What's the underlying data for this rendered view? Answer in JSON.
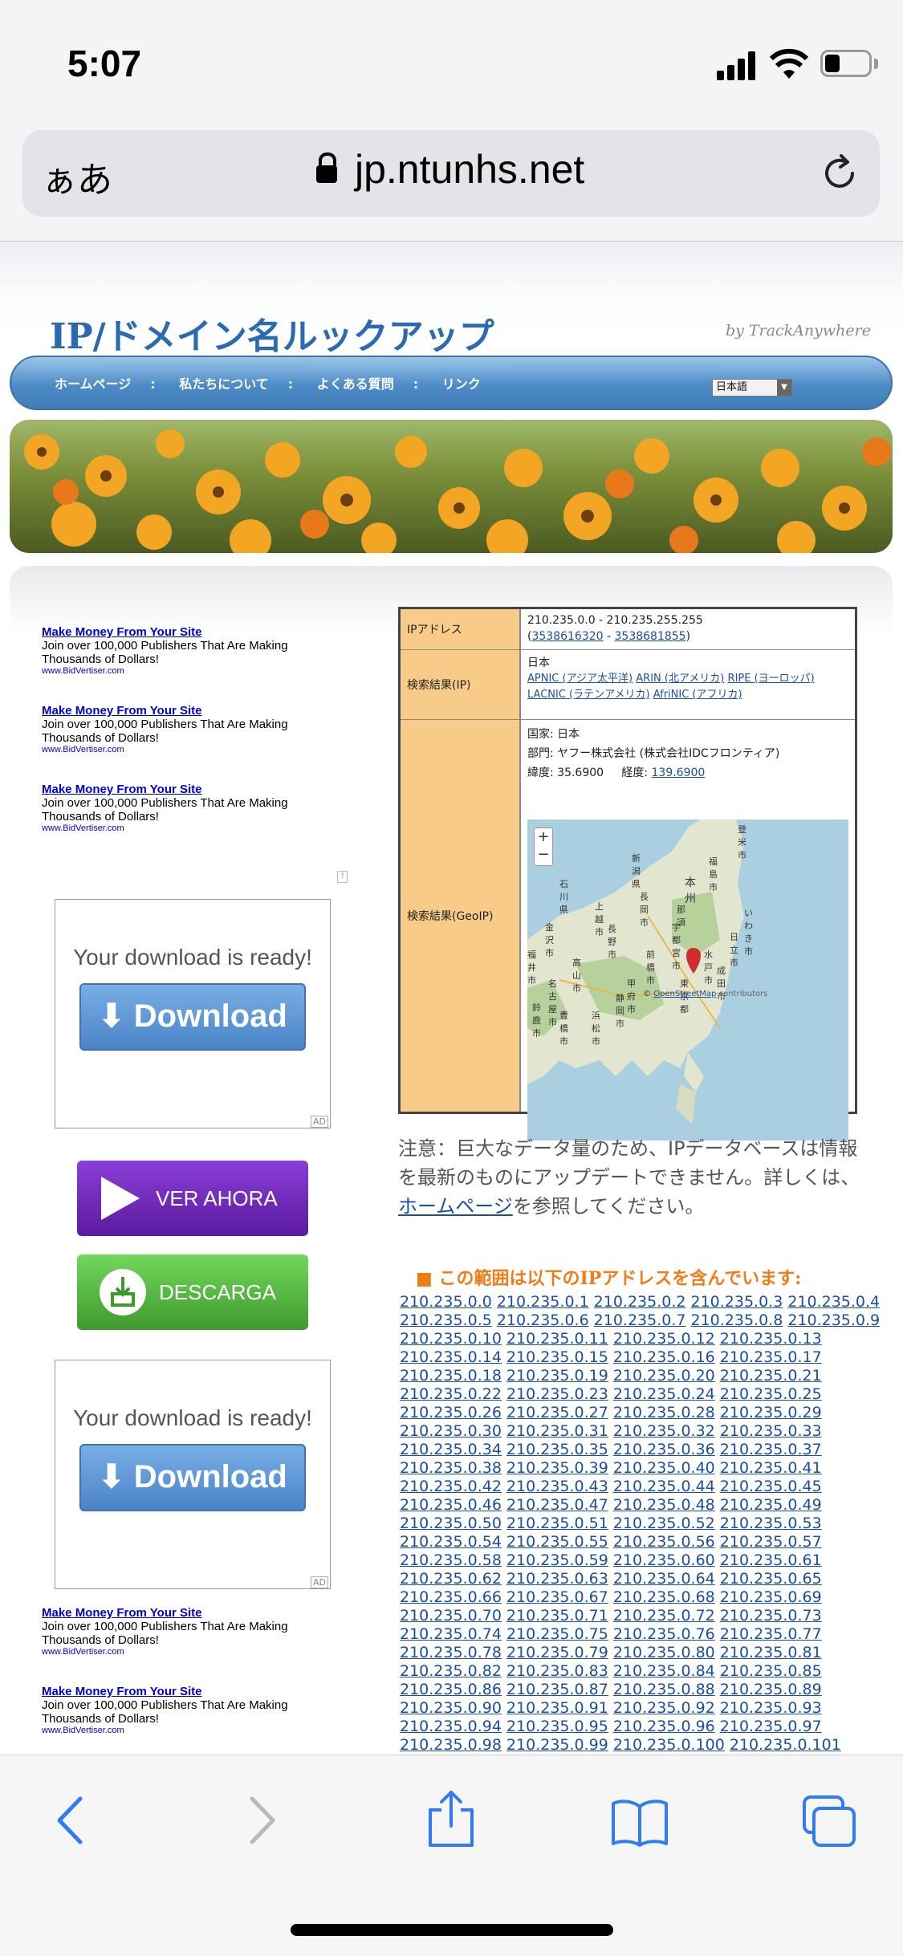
{
  "status": {
    "time": "5:07"
  },
  "browser": {
    "text_size_label": "ぁあ",
    "url": "jp.ntunhs.net"
  },
  "site": {
    "title": "IP/ドメイン名ルックアップ",
    "byline": "by TrackAnywhere",
    "nav": [
      "ホームページ",
      "私たちについて",
      "よくある質問",
      "リンク"
    ],
    "nav_separator": ":",
    "language": "日本語"
  },
  "ads": {
    "text_ads": [
      {
        "title": "Make Money From Your Site",
        "desc": "Join over 100,000 Publishers That Are Making Thousands of Dollars!",
        "url": "www.BidVertiser.com"
      },
      {
        "title": "Make Money From Your Site",
        "desc": "Join over 100,000 Publishers That Are Making Thousands of Dollars!",
        "url": "www.BidVertiser.com"
      },
      {
        "title": "Make Money From Your Site",
        "desc": "Join over 100,000 Publishers That Are Making Thousands of Dollars!",
        "url": "www.BidVertiser.com"
      },
      {
        "title": "Make Money From Your Site",
        "desc": "Join over 100,000 Publishers That Are Making Thousands of Dollars!",
        "url": "www.BidVertiser.com"
      },
      {
        "title": "Make Money From Your Site",
        "desc": "Join over 100,000 Publishers That Are Making Thousands of Dollars!",
        "url": "www.BidVertiser.com"
      }
    ],
    "download_ready": "Your download is ready!",
    "download_label": "Download",
    "ad_tag": "AD",
    "adinfo": "?",
    "ver_ahora": "VER AHORA",
    "descarga": "DESCARGA"
  },
  "info": {
    "ip_label": "IPアドレス",
    "ip_range": "210.235.0.0 - 210.235.255.255",
    "ip_num_start": "3538616320",
    "ip_num_end": "3538681855",
    "ip_num_sep": " - ",
    "paren_open": "(",
    "paren_close": ")",
    "result_ip_label": "検索結果(IP)",
    "country": "日本",
    "registries_line1": [
      "APNIC (アジア太平洋)",
      "ARIN (北アメリカ)",
      "RIPE (ヨーロッパ)"
    ],
    "registries_line2": [
      "LACNIC (ラテンアメリカ)",
      "AfriNIC (アフリカ)"
    ],
    "result_geo_label": "検索結果(GeoIP)",
    "geo_country": "国家: 日本",
    "geo_dept": "部門: ヤフー株式会社 (株式会社IDCフロンティア)",
    "lat_label": "緯度: 35.6900",
    "lon_label": "経度:",
    "lon_value": "139.6900",
    "map": {
      "zoom_in": "+",
      "zoom_out": "−",
      "labels": [
        "福島市",
        "本州",
        "長岡市",
        "上越市",
        "いわき市",
        "宇都宮市",
        "長野市",
        "金沢市",
        "前橋市",
        "日立市",
        "福井市",
        "水戸市",
        "高山市",
        "成田市",
        "名古屋市",
        "甲府市",
        "東京都",
        "静岡市",
        "豊橋市",
        "浜松市",
        "鈴鹿市",
        "石川県",
        "新潟県",
        "登米市",
        "那須"
      ],
      "credit_link": "OpenStreetMap",
      "credit_text": "contributors",
      "copyright": "©"
    }
  },
  "note": {
    "text": "注意：巨大なデータ量のため、IPデータベースは情報を最新のものにアップデートできません。詳しくは、",
    "link": "ホームページ",
    "tail": "を参照してください。"
  },
  "range_header": "■ この範囲は以下のIPアドレスを含んでいます:",
  "ip_lines": [
    [
      "210.235.0.0",
      "210.235.0.1",
      "210.235.0.2",
      "210.235.0.3",
      "210.235.0.4"
    ],
    [
      "210.235.0.5",
      "210.235.0.6",
      "210.235.0.7",
      "210.235.0.8",
      "210.235.0.9"
    ],
    [
      "210.235.0.10",
      "210.235.0.11",
      "210.235.0.12",
      "210.235.0.13"
    ],
    [
      "210.235.0.14",
      "210.235.0.15",
      "210.235.0.16",
      "210.235.0.17"
    ],
    [
      "210.235.0.18",
      "210.235.0.19",
      "210.235.0.20",
      "210.235.0.21"
    ],
    [
      "210.235.0.22",
      "210.235.0.23",
      "210.235.0.24",
      "210.235.0.25"
    ],
    [
      "210.235.0.26",
      "210.235.0.27",
      "210.235.0.28",
      "210.235.0.29"
    ],
    [
      "210.235.0.30",
      "210.235.0.31",
      "210.235.0.32",
      "210.235.0.33"
    ],
    [
      "210.235.0.34",
      "210.235.0.35",
      "210.235.0.36",
      "210.235.0.37"
    ],
    [
      "210.235.0.38",
      "210.235.0.39",
      "210.235.0.40",
      "210.235.0.41"
    ],
    [
      "210.235.0.42",
      "210.235.0.43",
      "210.235.0.44",
      "210.235.0.45"
    ],
    [
      "210.235.0.46",
      "210.235.0.47",
      "210.235.0.48",
      "210.235.0.49"
    ],
    [
      "210.235.0.50",
      "210.235.0.51",
      "210.235.0.52",
      "210.235.0.53"
    ],
    [
      "210.235.0.54",
      "210.235.0.55",
      "210.235.0.56",
      "210.235.0.57"
    ],
    [
      "210.235.0.58",
      "210.235.0.59",
      "210.235.0.60",
      "210.235.0.61"
    ],
    [
      "210.235.0.62",
      "210.235.0.63",
      "210.235.0.64",
      "210.235.0.65"
    ],
    [
      "210.235.0.66",
      "210.235.0.67",
      "210.235.0.68",
      "210.235.0.69"
    ],
    [
      "210.235.0.70",
      "210.235.0.71",
      "210.235.0.72",
      "210.235.0.73"
    ],
    [
      "210.235.0.74",
      "210.235.0.75",
      "210.235.0.76",
      "210.235.0.77"
    ],
    [
      "210.235.0.78",
      "210.235.0.79",
      "210.235.0.80",
      "210.235.0.81"
    ],
    [
      "210.235.0.82",
      "210.235.0.83",
      "210.235.0.84",
      "210.235.0.85"
    ],
    [
      "210.235.0.86",
      "210.235.0.87",
      "210.235.0.88",
      "210.235.0.89"
    ],
    [
      "210.235.0.90",
      "210.235.0.91",
      "210.235.0.92",
      "210.235.0.93"
    ],
    [
      "210.235.0.94",
      "210.235.0.95",
      "210.235.0.96",
      "210.235.0.97"
    ],
    [
      "210.235.0.98",
      "210.235.0.99",
      "210.235.0.100",
      "210.235.0.101"
    ]
  ],
  "toolbar": {
    "icons": [
      "back-icon",
      "forward-icon",
      "share-icon",
      "bookmarks-icon",
      "tabs-icon"
    ]
  }
}
